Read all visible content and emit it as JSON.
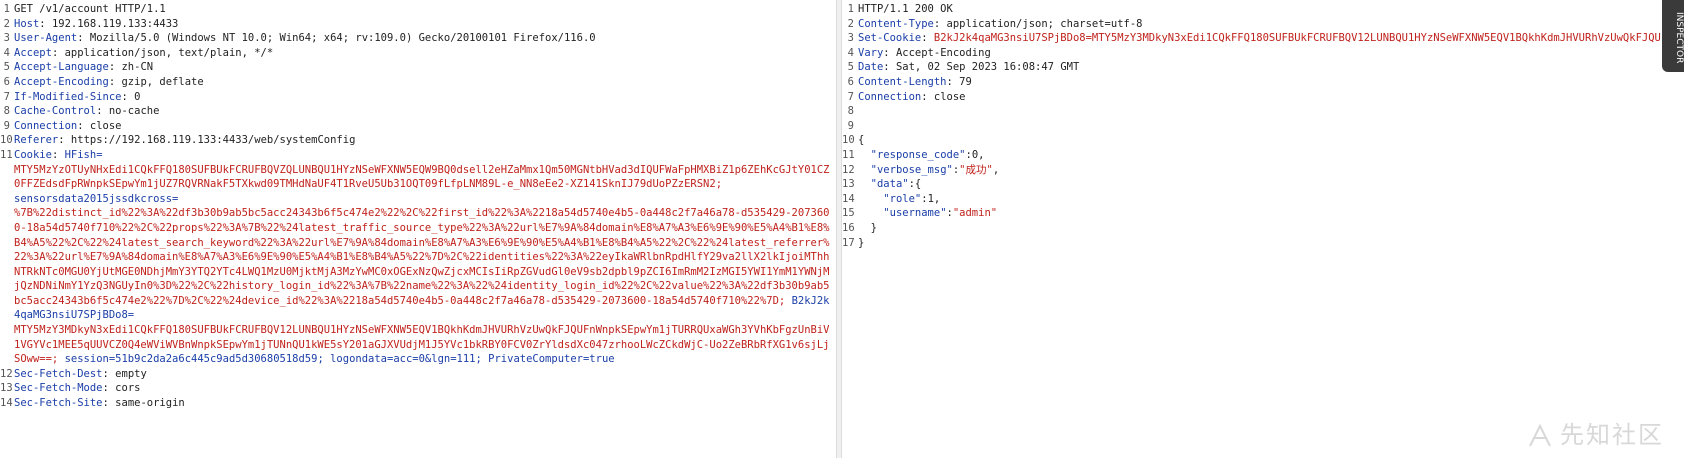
{
  "request": {
    "line1": "GET /v1/account HTTP/1.1",
    "headers": [
      {
        "k": "Host",
        "v": "192.168.119.133:4433"
      },
      {
        "k": "User-Agent",
        "v": "Mozilla/5.0 (Windows NT 10.0; Win64; x64; rv:109.0) Gecko/20100101 Firefox/116.0"
      },
      {
        "k": "Accept",
        "v": "application/json, text/plain, */*"
      },
      {
        "k": "Accept-Language",
        "v": "zh-CN"
      },
      {
        "k": "Accept-Encoding",
        "v": "gzip, deflate"
      },
      {
        "k": "If-Modified-Since",
        "v": "0"
      },
      {
        "k": "Cache-Control",
        "v": "no-cache"
      },
      {
        "k": "Connection",
        "v": "close"
      },
      {
        "k": "Referer",
        "v": "https://192.168.119.133:4433/web/systemConfig"
      }
    ],
    "cookie_label": "Cookie",
    "cookie_hfish_key": "HFish=",
    "cookie_hfish_val": "MTY5MzYzOTUyNHxEdi1CQkFFQ180SUFBUkFCRUFBQVZQLUNBQU1HYzNSeWFXNW5EQW9BQ0dsell2eHZaMmx1Qm50MGNtbHVad3dIQUFWaFpHMXBiZ1p6ZEhKcGJtY01CZ0FFZEdsdFpRWnpkSEpwYm1jUZ7RQVRNakF5TXkwd09TMHdNaUF4T1RveU5Ub31OQT09fLfpLNM89L-e_NN8eEe2-XZ141SknIJ79dUoPZzERSN2;",
    "sensors_key": "sensorsdata2015jssdkcross=",
    "sensors_val": "%7B%22distinct_id%22%3A%22df3b30b9ab5bc5acc24343b6f5c474e2%22%2C%22first_id%22%3A%2218a54d5740e4b5-0a448c2f7a46a78-d535429-2073600-18a54d5740f710%22%2C%22props%22%3A%7B%22%24latest_traffic_source_type%22%3A%22url%E7%9A%84domain%E8%A7%A3%E6%9E%90%E5%A4%B1%E8%B4%A5%22%2C%22%24latest_search_keyword%22%3A%22url%E7%9A%84domain%E8%A7%A3%E6%9E%90%E5%A4%B1%E8%B4%A5%22%2C%22%24latest_referrer%22%3A%22url%E7%9A%84domain%E8%A7%A3%E6%9E%90%E5%A4%B1%E8%B4%A5%22%7D%2C%22identities%22%3A%22eyIkaWRlbnRpdHlfY29va2llX2lkIjoiMThhNTRkNTc0MGU0YjUtMGE0NDhjMmY3YTQ2YTc4LWQ1MzU0MjktMjA3MzYwMC0xOGExNzQwZjcxMCIsIiRpZGVudGl0eV9sb2dpbl9pZCI6ImRmM2IzMGI5YWI1YmM1YWNjMjQzNDNiNmY1YzQ3NGUyIn0%3D%22%2C%22history_login_id%22%3A%7B%22name%22%3A%22%24identity_login_id%22%2C%22value%22%3A%22df3b30b9ab5bc5acc24343b6f5c474e2%22%7D%2C%22%24device_id%22%3A%2218a54d5740e4b5-0a448c2f7a46a78-d535429-2073600-18a54d5740f710%22%7D;",
    "b2k_key": "B2kJ2k4qaMG3nsiU7SPjBDo8=",
    "b2k_val": "MTY5MzY3MDkyN3xEdi1CQkFFQ180SUFBUkFCRUFBQV12LUNBQU1HYzNSeWFXNW5EQV1BQkhKdmJHVURhVzUwQkFJQUFnWnpkSEpwYm1jTURRQUxaWGh3YVhKbFgzUnBiV1VGYVc1MEE5qUUVCZ0Q4eWViWVBnWnpkSEpwYm1jTUNnQU1kWE5sY201aGJXVUdjM1J5YVc1bkRBY0FCV0ZrYldsdXc047zrhooLWcZCkdWjC-Uo2ZeBRbRfXG1v6sjLjSOww==;",
    "session_text": "session=51b9c2da2a6c445c9ad5d30680518d59;",
    "logondata_text": "logondata=acc=0&lgn=111;",
    "private_text": "PrivateComputer=true",
    "fetch_headers": [
      {
        "k": "Sec-Fetch-Dest",
        "v": "empty"
      },
      {
        "k": "Sec-Fetch-Mode",
        "v": "cors"
      },
      {
        "k": "Sec-Fetch-Site",
        "v": "same-origin"
      }
    ]
  },
  "response": {
    "status_line": "HTTP/1.1 200 OK",
    "headers": [
      {
        "k": "Content-Type",
        "v": "application/json; charset=utf-8"
      },
      {
        "k": "Set-Cookie",
        "v": "B2kJ2k4qaMG3nsiU7SPjBDo8=MTY5MzY3MDkyN3xEdi1CQkFFQ180SUFBUkFCRUFBQV12LUNBQU1HYzNSeWFXNW5EQV1BQkhKdmJHVURhVzUwQkFJQU"
      },
      {
        "k": "Vary",
        "v": "Accept-Encoding"
      },
      {
        "k": "Date",
        "v": "Sat, 02 Sep 2023 16:08:47 GMT"
      },
      {
        "k": "Content-Length",
        "v": "79"
      },
      {
        "k": "Connection",
        "v": "close"
      }
    ],
    "json": {
      "response_code_key": "\"response_code\"",
      "response_code_val": "0",
      "verbose_msg_key": "\"verbose_msg\"",
      "verbose_msg_val": "\"成功\"",
      "data_key": "\"data\"",
      "role_key": "\"role\"",
      "role_val": "1",
      "username_key": "\"username\"",
      "username_val": "\"admin\""
    }
  },
  "ui": {
    "inspector_label": "INSPECTOR",
    "watermark_text": "先知社区",
    "splitter_glyph": "⋮",
    "colon": ":",
    "comma": ",",
    "brace_open": "{",
    "brace_close": "}"
  }
}
